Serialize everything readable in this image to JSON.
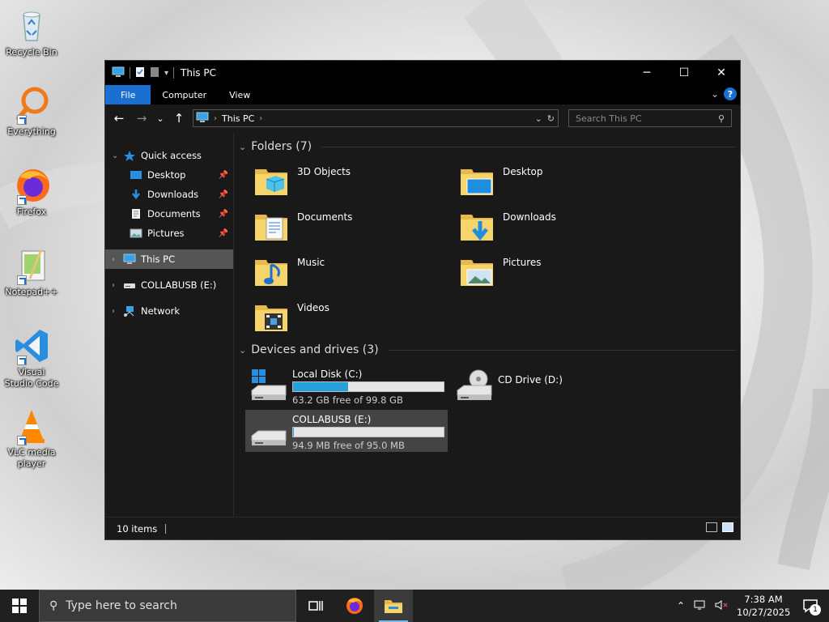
{
  "desktop": {
    "icons": [
      {
        "label": "Recycle Bin",
        "icon": "recycle-bin-icon"
      },
      {
        "label": "Everything",
        "icon": "everything-search-icon"
      },
      {
        "label": "Firefox",
        "icon": "firefox-icon"
      },
      {
        "label": "Notepad++",
        "icon": "notepad-plus-plus-icon"
      },
      {
        "label": "Visual Studio Code",
        "icon": "vscode-icon"
      },
      {
        "label": "VLC media player",
        "icon": "vlc-icon"
      }
    ]
  },
  "window": {
    "title": "This PC",
    "controls": {
      "minimize": "─",
      "maximize": "☐",
      "close": "✕"
    },
    "ribbon_tabs": [
      "File",
      "Computer",
      "View"
    ],
    "help": "?",
    "nav": {
      "back": "←",
      "forward": "→",
      "recent": "⌄",
      "up": "↑"
    },
    "address": {
      "location": "This PC"
    },
    "search": {
      "placeholder": "Search This PC"
    }
  },
  "sidebar": {
    "quick_access": "Quick access",
    "quick_items": [
      "Desktop",
      "Downloads",
      "Documents",
      "Pictures"
    ],
    "this_pc": "This PC",
    "usb": "COLLABUSB (E:)",
    "network": "Network"
  },
  "main": {
    "folders_header": "Folders (7)",
    "folders": [
      {
        "name": "3D Objects",
        "icon": "3d-objects-folder-icon"
      },
      {
        "name": "Desktop",
        "icon": "desktop-folder-icon"
      },
      {
        "name": "Documents",
        "icon": "documents-folder-icon"
      },
      {
        "name": "Downloads",
        "icon": "downloads-folder-icon"
      },
      {
        "name": "Music",
        "icon": "music-folder-icon"
      },
      {
        "name": "Pictures",
        "icon": "pictures-folder-icon"
      },
      {
        "name": "Videos",
        "icon": "videos-folder-icon"
      }
    ],
    "devices_header": "Devices and drives (3)",
    "drives": [
      {
        "name": "Local Disk (C:)",
        "free": "63.2 GB free of 99.8 GB",
        "used_fraction": 0.367
      },
      {
        "name": "CD Drive (D:)",
        "free": "",
        "used_fraction": null
      },
      {
        "name": "COLLABUSB (E:)",
        "free": "94.9 MB free of 95.0 MB",
        "used_fraction": 0.001
      }
    ]
  },
  "status": {
    "items": "10 items"
  },
  "taskbar": {
    "search_placeholder": "Type here to search",
    "time": "7:38 AM",
    "date": "10/27/2025",
    "notifications": "1"
  },
  "colors": {
    "accent": "#1a6fd0",
    "drive_fill": "#26a0da",
    "window_bg": "#191919"
  }
}
